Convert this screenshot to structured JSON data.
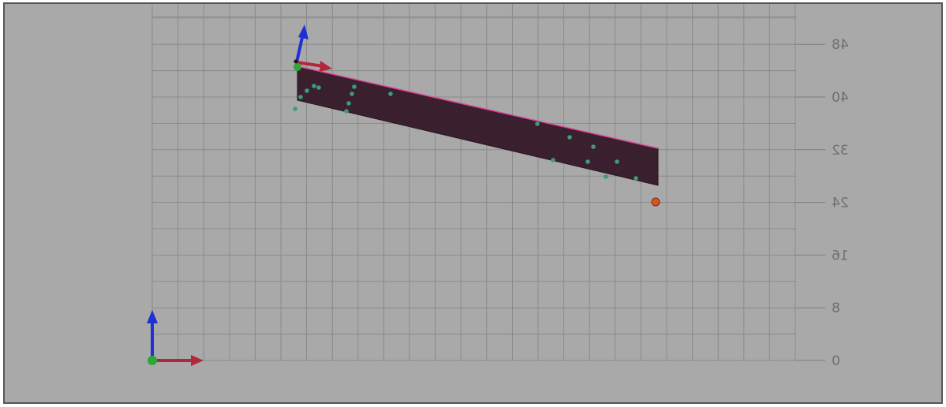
{
  "viewport": {
    "background": "#a9a9a9",
    "grid_color": "#8a8a8a",
    "border_color": "#555555"
  },
  "axis": {
    "tick_labels": [
      "0",
      "8",
      "16",
      "24",
      "32",
      "40",
      "48"
    ],
    "label_style": "mirrored"
  },
  "scene": {
    "panel_color": "#3a1f2e",
    "panel_edge_color": "#e0459a",
    "point_color": "#3f9a7a",
    "marker_color": "#d9541e",
    "gizmo_x_color": "#b0283a",
    "gizmo_z_color": "#1f2fd6",
    "gizmo_origin_color": "#2fa63a",
    "world_gizmo": {
      "icons": [
        "x-arrow-icon",
        "z-arrow-icon",
        "origin-dot-icon"
      ]
    },
    "object_gizmo": {
      "icons": [
        "x-arrow-icon",
        "z-arrow-icon",
        "origin-dot-icon"
      ]
    }
  }
}
